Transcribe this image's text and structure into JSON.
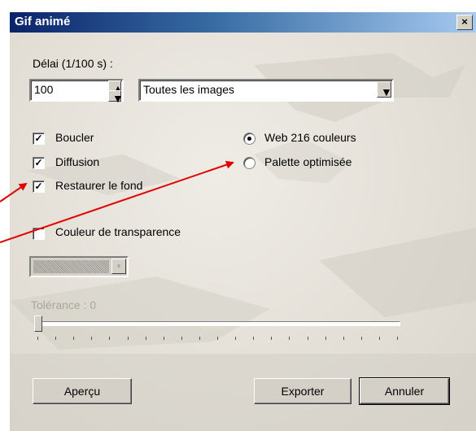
{
  "window": {
    "title": "Gif animé",
    "close_label": "×"
  },
  "delay": {
    "label": "Délai (1/100 s) :",
    "value": "100",
    "scope_selected": "Toutes les images"
  },
  "checkboxes": [
    {
      "label": "Boucler",
      "checked": true
    },
    {
      "label": "Diffusion",
      "checked": true
    },
    {
      "label": "Restaurer le fond",
      "checked": true
    }
  ],
  "palette": [
    {
      "label": "Web 216 couleurs",
      "selected": true
    },
    {
      "label": "Palette optimisée",
      "selected": false
    }
  ],
  "transparency": {
    "label": "Couleur de transparence",
    "checked": false
  },
  "tolerance": {
    "label": "Tolérance : 0",
    "value": 0
  },
  "buttons": {
    "preview": "Aperçu",
    "export": "Exporter",
    "cancel": "Annuler"
  },
  "check_mark": "✓",
  "colors": {
    "annotation_arrow": "#e00000",
    "title_bar": "#0a246a"
  }
}
